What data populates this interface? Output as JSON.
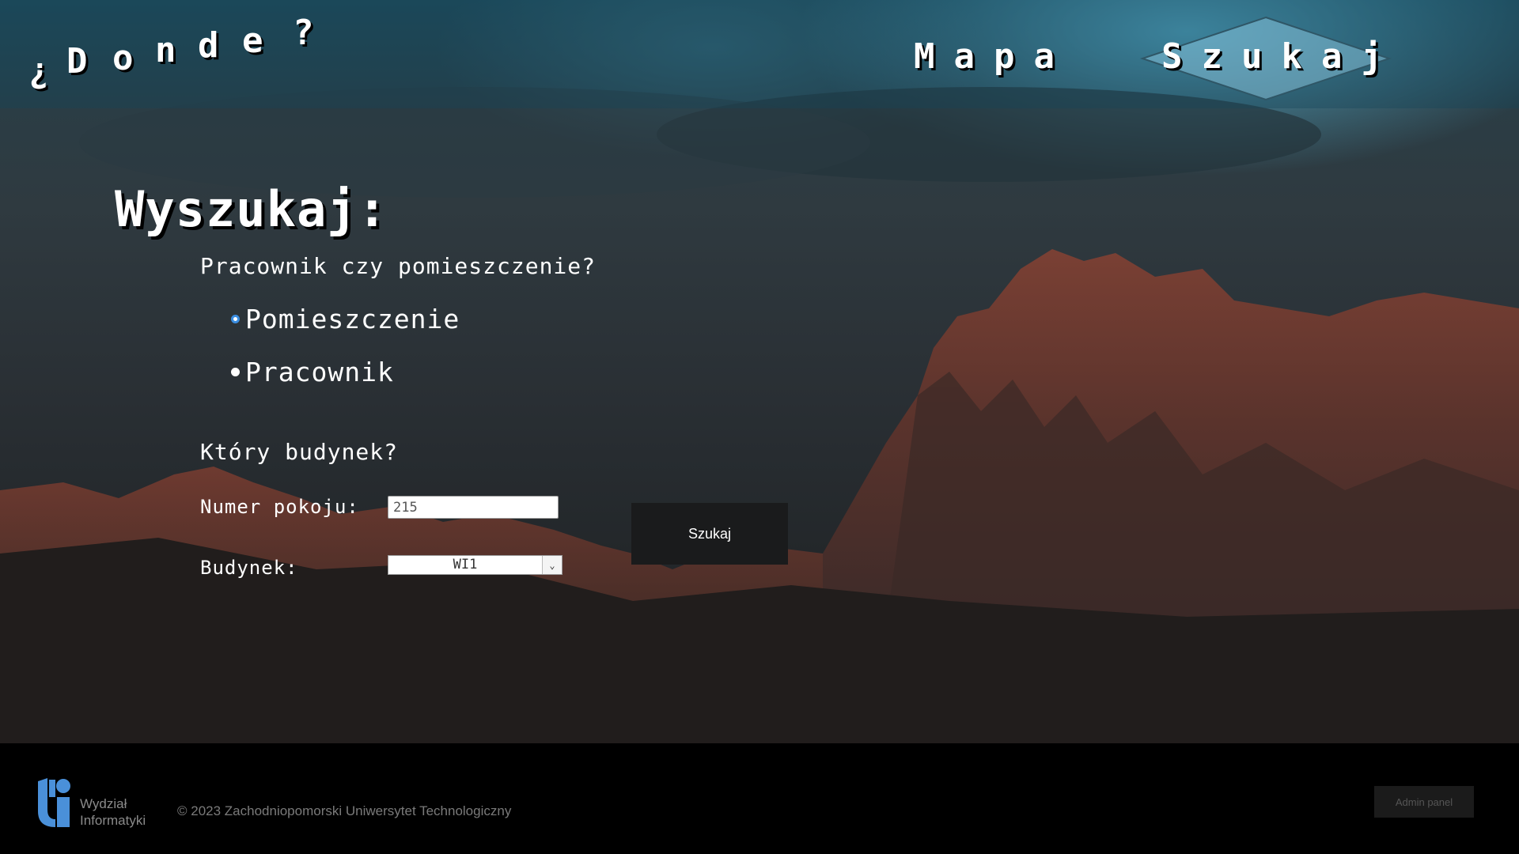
{
  "header": {
    "logo_text": "¿Donde?",
    "nav_mapa": "Mapa",
    "nav_szukaj": "Szukaj"
  },
  "search": {
    "title": "Wyszukaj:",
    "question_type": "Pracownik czy pomieszczenie?",
    "options": [
      {
        "label": "Pomieszczenie",
        "checked": true
      },
      {
        "label": "Pracownik",
        "checked": false
      }
    ],
    "question_building": "Który budynek?",
    "room_label": "Numer pokoju:",
    "room_value": "215",
    "building_label": "Budynek:",
    "building_selected": "WI1",
    "submit_label": "Szukaj"
  },
  "footer": {
    "logo_line1": "Wydział",
    "logo_line2": "Informatyki",
    "copyright": "© 2023 Zachodniopomorski Uniwersytet Technologiczny",
    "admin_label": "Admin panel"
  },
  "colors": {
    "radio_accent": "#3a8de0",
    "logo_blue": "#4a90d9"
  }
}
